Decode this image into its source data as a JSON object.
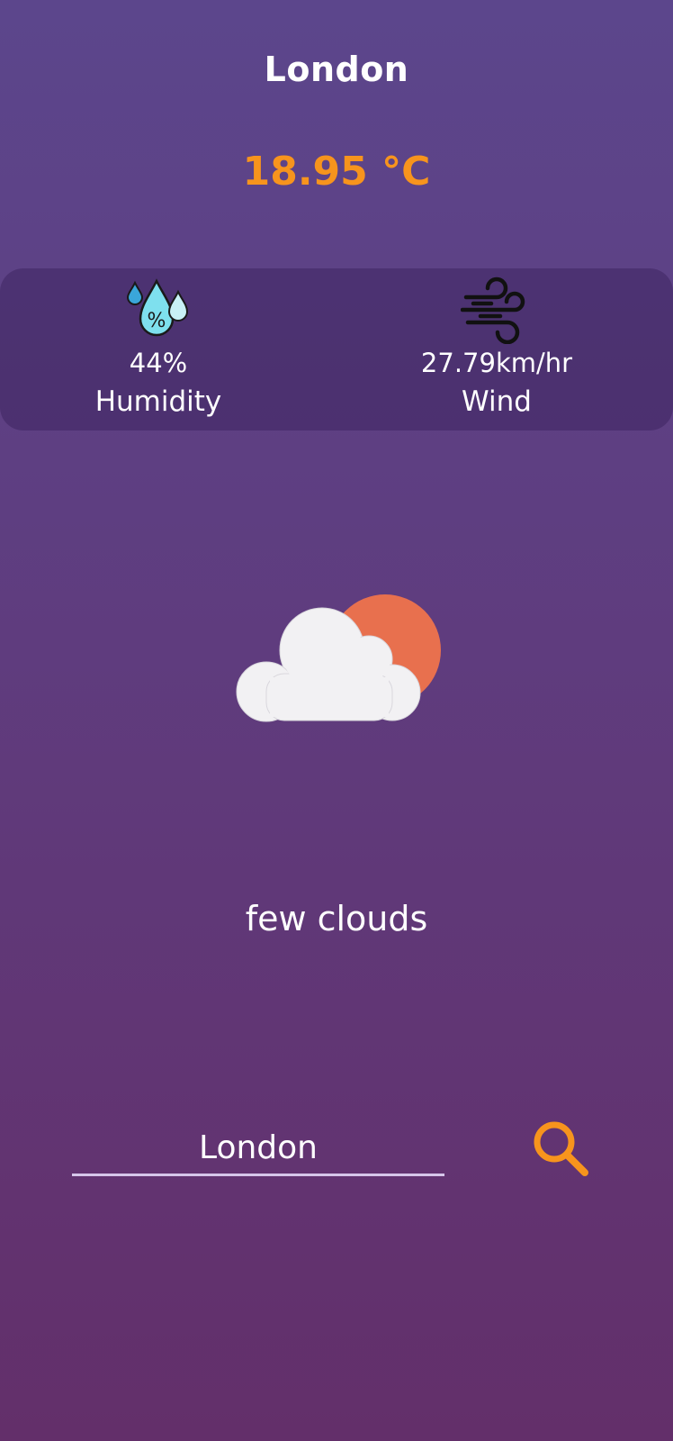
{
  "weather": {
    "city": "London",
    "temperature": "18.95 °C",
    "humidity": {
      "value": "44%",
      "label": "Humidity",
      "icon": "humidity-drops-icon"
    },
    "wind": {
      "value": "27.79km/hr",
      "label": "Wind",
      "icon": "wind-icon"
    },
    "condition_icon": "few-clouds-icon",
    "description": "few clouds"
  },
  "search": {
    "value": "London",
    "icon": "search-icon"
  },
  "colors": {
    "background_top": "#5c468c",
    "background_bottom": "#632f6a",
    "accent": "#f7941d",
    "sun": "#e8704e",
    "cloud": "#f2f1f3",
    "humidity_drop": "#7ee0ee"
  }
}
